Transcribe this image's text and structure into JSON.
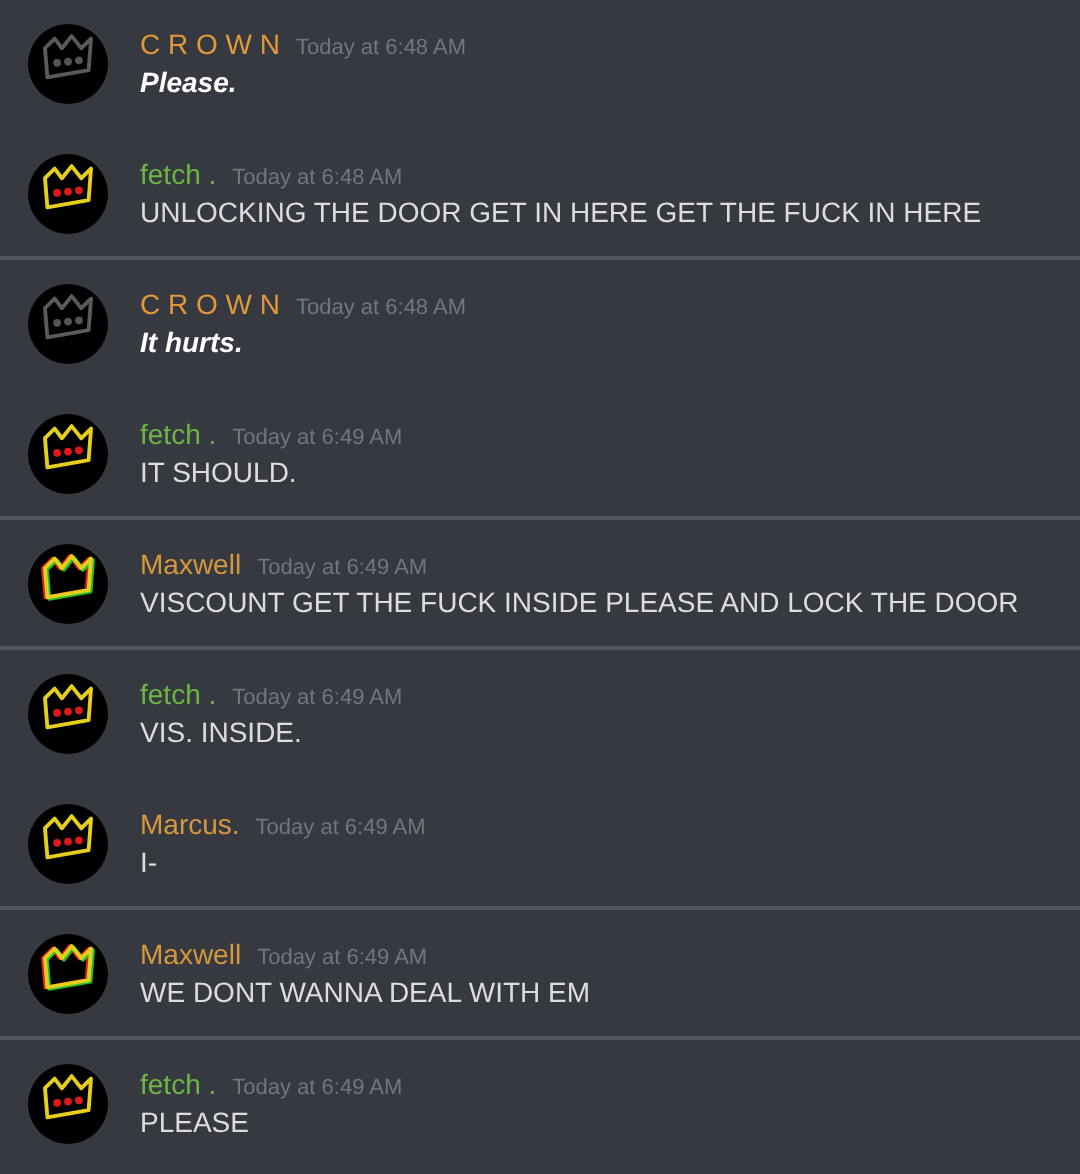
{
  "messages": [
    {
      "author": "C R O W N",
      "color": "#e0983a",
      "kind": "grey",
      "time": "Today at 6:48 AM",
      "text": "Please.",
      "emphasized": true,
      "divider_after": false
    },
    {
      "author": "fetch .",
      "color": "#6db646",
      "kind": "yellow",
      "time": "Today at 6:48 AM",
      "text": "UNLOCKING THE DOOR GET IN HERE GET THE FUCK IN HERE",
      "emphasized": false,
      "divider_after": true
    },
    {
      "author": "C R O W N",
      "color": "#e0983a",
      "kind": "grey",
      "time": "Today at 6:48 AM",
      "text": "It hurts.",
      "emphasized": true,
      "divider_after": false
    },
    {
      "author": "fetch .",
      "color": "#6db646",
      "kind": "yellow",
      "time": "Today at 6:49 AM",
      "text": "IT SHOULD.",
      "emphasized": false,
      "divider_after": true
    },
    {
      "author": "Maxwell",
      "color": "#d6973f",
      "kind": "glitch",
      "time": "Today at 6:49 AM",
      "text": "VISCOUNT GET THE FUCK INSIDE PLEASE AND LOCK THE DOOR",
      "emphasized": false,
      "divider_after": true
    },
    {
      "author": "fetch .",
      "color": "#6db646",
      "kind": "yellow",
      "time": "Today at 6:49 AM",
      "text": "VIS. INSIDE.",
      "emphasized": false,
      "divider_after": false
    },
    {
      "author": "Marcus.",
      "color": "#d6973f",
      "kind": "yellow",
      "time": "Today at 6:49 AM",
      "text": "I-",
      "emphasized": false,
      "divider_after": true
    },
    {
      "author": "Maxwell",
      "color": "#d6973f",
      "kind": "glitch",
      "time": "Today at 6:49 AM",
      "text": "WE DONT WANNA DEAL WITH EM",
      "emphasized": false,
      "divider_after": true
    },
    {
      "author": "fetch .",
      "color": "#6db646",
      "kind": "yellow",
      "time": "Today at 6:49 AM",
      "text": "PLEASE",
      "emphasized": false,
      "divider_after": false
    }
  ]
}
